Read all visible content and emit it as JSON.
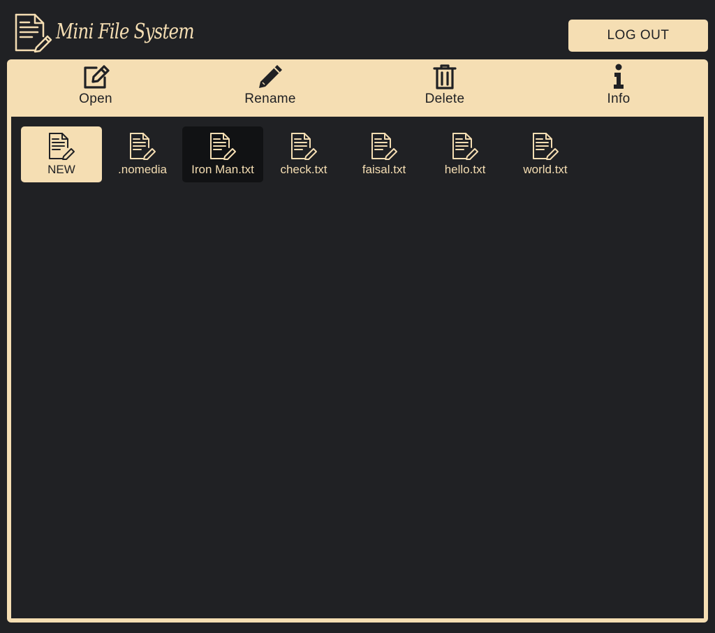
{
  "app": {
    "title": "Mini File System"
  },
  "header": {
    "logout_label": "LOG OUT"
  },
  "toolbar": {
    "open_label": "Open",
    "rename_label": "Rename",
    "delete_label": "Delete",
    "info_label": "Info"
  },
  "files": [
    {
      "name": "NEW",
      "icon": "new-file-icon",
      "state": "new"
    },
    {
      "name": ".nomedia",
      "icon": "file-icon",
      "state": "normal"
    },
    {
      "name": "Iron Man.txt",
      "icon": "file-icon",
      "state": "selected"
    },
    {
      "name": "check.txt",
      "icon": "file-icon",
      "state": "normal"
    },
    {
      "name": "faisal.txt",
      "icon": "file-icon",
      "state": "normal"
    },
    {
      "name": "hello.txt",
      "icon": "file-icon",
      "state": "normal"
    },
    {
      "name": "world.txt",
      "icon": "file-icon",
      "state": "normal"
    }
  ],
  "colors": {
    "background": "#202124",
    "accent": "#f5deb3",
    "selected": "#111214"
  }
}
